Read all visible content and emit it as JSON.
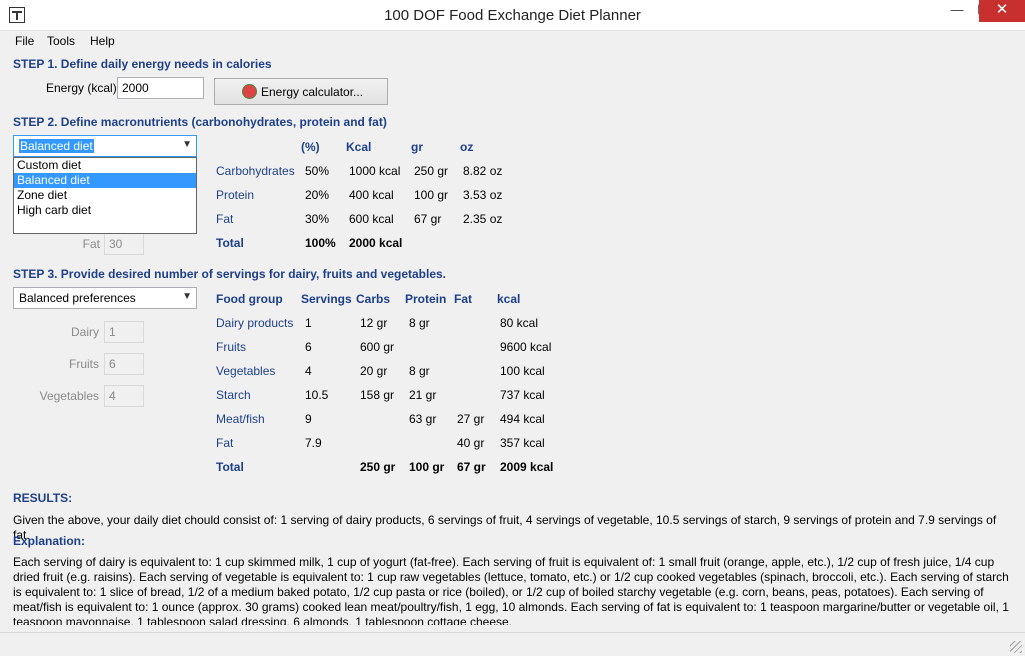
{
  "window": {
    "title": "100 DOF Food Exchange Diet Planner"
  },
  "menu": [
    "File",
    "Tools",
    "Help"
  ],
  "step1": {
    "heading": "STEP 1. Define daily energy needs in calories",
    "energy_label": "Energy (kcal)",
    "energy_value": "2000",
    "calculator_button": "Energy calculator..."
  },
  "step2": {
    "heading": "STEP 2. Define macronutrients (carbonohydrates, protein and fat)",
    "diet_selected": "Balanced diet",
    "diet_options": [
      "Custom diet",
      "Balanced diet",
      "Zone diet",
      "High carb diet"
    ],
    "fat_label": "Fat",
    "fat_value": "30",
    "headers": [
      "(%)",
      "Kcal",
      "gr",
      "oz"
    ],
    "rows": [
      {
        "label": "Carbohydrates",
        "pct": "50%",
        "kcal": "1000 kcal",
        "gr": "250 gr",
        "oz": "8.82 oz"
      },
      {
        "label": "Protein",
        "pct": "20%",
        "kcal": "400 kcal",
        "gr": "100 gr",
        "oz": "3.53 oz"
      },
      {
        "label": "Fat",
        "pct": "30%",
        "kcal": "600 kcal",
        "gr": "67 gr",
        "oz": "2.35 oz"
      }
    ],
    "total": {
      "label": "Total",
      "pct": "100%",
      "kcal": "2000 kcal"
    }
  },
  "step3": {
    "heading": "STEP 3. Provide desired number of servings for dairy, fruits and vegetables.",
    "preference_selected": "Balanced preferences",
    "inputs": [
      {
        "label": "Dairy",
        "value": "1"
      },
      {
        "label": "Fruits",
        "value": "6"
      },
      {
        "label": "Vegetables",
        "value": "4"
      }
    ],
    "headers": [
      "Food group",
      "Servings",
      "Carbs",
      "Protein",
      "Fat",
      "kcal"
    ],
    "rows": [
      {
        "group": "Dairy products",
        "servings": "1",
        "carbs": "12 gr",
        "protein": "8 gr",
        "fat": "",
        "kcal": "80 kcal"
      },
      {
        "group": "Fruits",
        "servings": "6",
        "carbs": "600 gr",
        "protein": "",
        "fat": "",
        "kcal": "9600 kcal"
      },
      {
        "group": "Vegetables",
        "servings": "4",
        "carbs": "20 gr",
        "protein": "8 gr",
        "fat": "",
        "kcal": "100 kcal"
      },
      {
        "group": "Starch",
        "servings": "10.5",
        "carbs": "158 gr",
        "protein": "21 gr",
        "fat": "",
        "kcal": "737 kcal"
      },
      {
        "group": "Meat/fish",
        "servings": "9",
        "carbs": "",
        "protein": "63 gr",
        "fat": "27 gr",
        "kcal": "494 kcal"
      },
      {
        "group": "Fat",
        "servings": "7.9",
        "carbs": "",
        "protein": "",
        "fat": "40 gr",
        "kcal": "357 kcal"
      }
    ],
    "total": {
      "label": "Total",
      "carbs": "250 gr",
      "protein": "100 gr",
      "fat": "67 gr",
      "kcal": "2009 kcal"
    }
  },
  "results": {
    "heading": "RESULTS:",
    "text": "Given the above, your daily diet chould consist of: 1 serving of dairy products, 6 servings of fruit, 4 servings of vegetable, 10.5 servings of starch, 9 servings of protein and 7.9 servings of fat.",
    "explanation_heading": "Explanation:",
    "explanation": "Each serving of dairy is equivalent to: 1 cup skimmed milk, 1 cup of yogurt (fat-free). Each serving of fruit is equivalent of: 1 small fruit (orange, apple, etc.), 1/2 cup of fresh juice, 1/4 cup dried fruit (e.g. raisins). Each serving of vegetable is equivalent to: 1 cup raw vegetables (lettuce, tomato, etc.) or 1/2 cup cooked vegetables (spinach, broccoli, etc.). Each serving of starch is equivalent to: 1 slice of bread, 1/2 of a medium baked potato, 1/2 cup pasta or rice (boiled), or 1/2 cup of boiled starchy vegetable (e.g. corn, beans, peas, potatoes). Each serving of meat/fish is equivalent to: 1 ounce (approx. 30 grams) cooked lean meat/poultry/fish, 1 egg, 10 almonds. Each serving of fat is equivalent to: 1 teaspoon margarine/butter or vegetable oil, 1 teaspoon mayonnaise, 1 tablespoon salad dressing, 6 almonds, 1 tablespoon cottage cheese."
  }
}
